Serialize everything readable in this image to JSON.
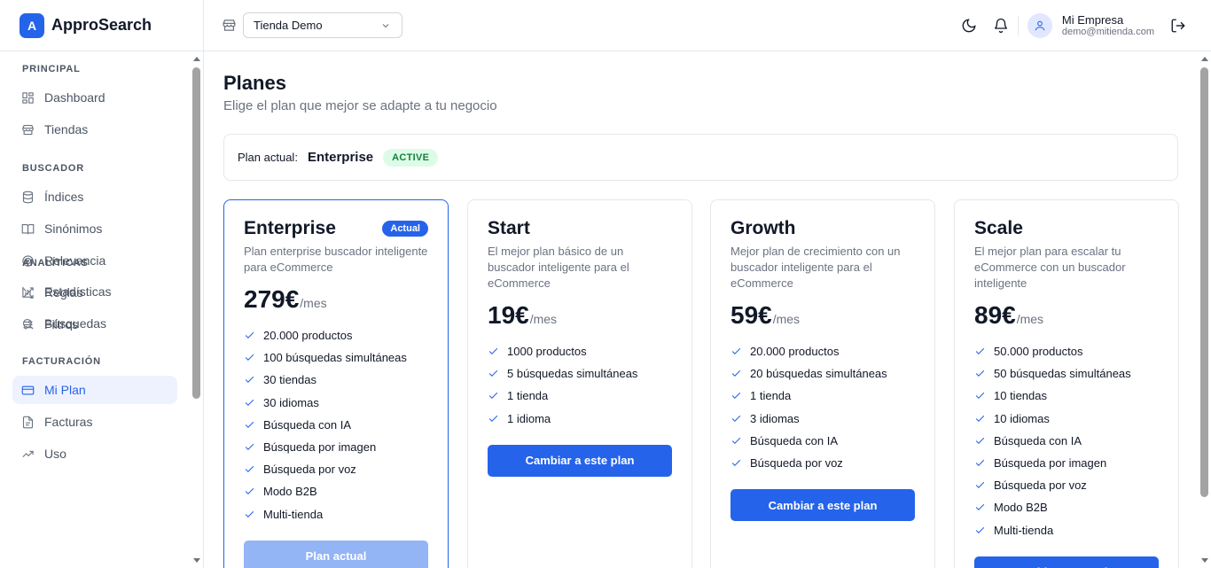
{
  "brand": {
    "logo_letter": "A",
    "name": "ApproSearch"
  },
  "sidebar": {
    "sections": [
      {
        "title": "PRINCIPAL",
        "items": [
          {
            "label": "Dashboard",
            "icon": "dashboard-icon"
          },
          {
            "label": "Tiendas",
            "icon": "store-icon"
          }
        ]
      },
      {
        "title": "BUSCADOR",
        "items": [
          {
            "label": "Índices",
            "icon": "database-icon"
          },
          {
            "label": "Sinónimos",
            "icon": "book-icon"
          },
          {
            "label": "Relevancia",
            "icon": "target-icon"
          },
          {
            "label": "Reglas",
            "icon": "shuffle-icon"
          },
          {
            "label": "Filtros",
            "icon": "sliders-icon"
          }
        ]
      },
      {
        "title": "ANALÍTICAS",
        "items": [
          {
            "label": "Estadísticas",
            "icon": "bar-chart-icon"
          },
          {
            "label": "Búsquedas",
            "icon": "search-icon"
          }
        ]
      },
      {
        "title": "FACTURACIÓN",
        "items": [
          {
            "label": "Mi Plan",
            "icon": "credit-card-icon",
            "active": true
          },
          {
            "label": "Facturas",
            "icon": "file-icon"
          },
          {
            "label": "Uso",
            "icon": "trend-icon"
          }
        ]
      }
    ]
  },
  "topbar": {
    "store_select": {
      "value": "Tienda Demo"
    },
    "user": {
      "name": "Mi Empresa",
      "email": "demo@mitienda.com"
    }
  },
  "page": {
    "title": "Planes",
    "subtitle": "Elige el plan que mejor se adapte a tu negocio",
    "current_plan": {
      "label": "Plan actual:",
      "name": "Enterprise",
      "status": "ACTIVE"
    }
  },
  "plans": [
    {
      "name": "Enterprise",
      "badge": "Actual",
      "description": "Plan enterprise buscador inteligente para eCommerce",
      "price": "279€",
      "period": "/mes",
      "features": [
        "20.000 productos",
        "100 búsquedas simultáneas",
        "30 tiendas",
        "30 idiomas",
        "Búsqueda con IA",
        "Búsqueda por imagen",
        "Búsqueda por voz",
        "Modo B2B",
        "Multi-tienda"
      ],
      "button": "Plan actual",
      "current": true
    },
    {
      "name": "Start",
      "description": "El mejor plan básico de un buscador inteligente para el eCommerce",
      "price": "19€",
      "period": "/mes",
      "features": [
        "1000 productos",
        "5 búsquedas simultáneas",
        "1 tienda",
        "1 idioma"
      ],
      "button": "Cambiar a este plan"
    },
    {
      "name": "Growth",
      "description": "Mejor plan de crecimiento con un buscador inteligente para el eCommerce",
      "price": "59€",
      "period": "/mes",
      "features": [
        "20.000 productos",
        "20 búsquedas simultáneas",
        "1 tienda",
        "3 idiomas",
        "Búsqueda con IA",
        "Búsqueda por voz"
      ],
      "button": "Cambiar a este plan"
    },
    {
      "name": "Scale",
      "description": "El mejor plan para escalar tu eCommerce con un buscador inteligente",
      "price": "89€",
      "period": "/mes",
      "features": [
        "50.000 productos",
        "50 búsquedas simultáneas",
        "10 tiendas",
        "10 idiomas",
        "Búsqueda con IA",
        "Búsqueda por imagen",
        "Búsqueda por voz",
        "Modo B2B",
        "Multi-tienda"
      ],
      "button": "Cambiar a este plan"
    }
  ]
}
